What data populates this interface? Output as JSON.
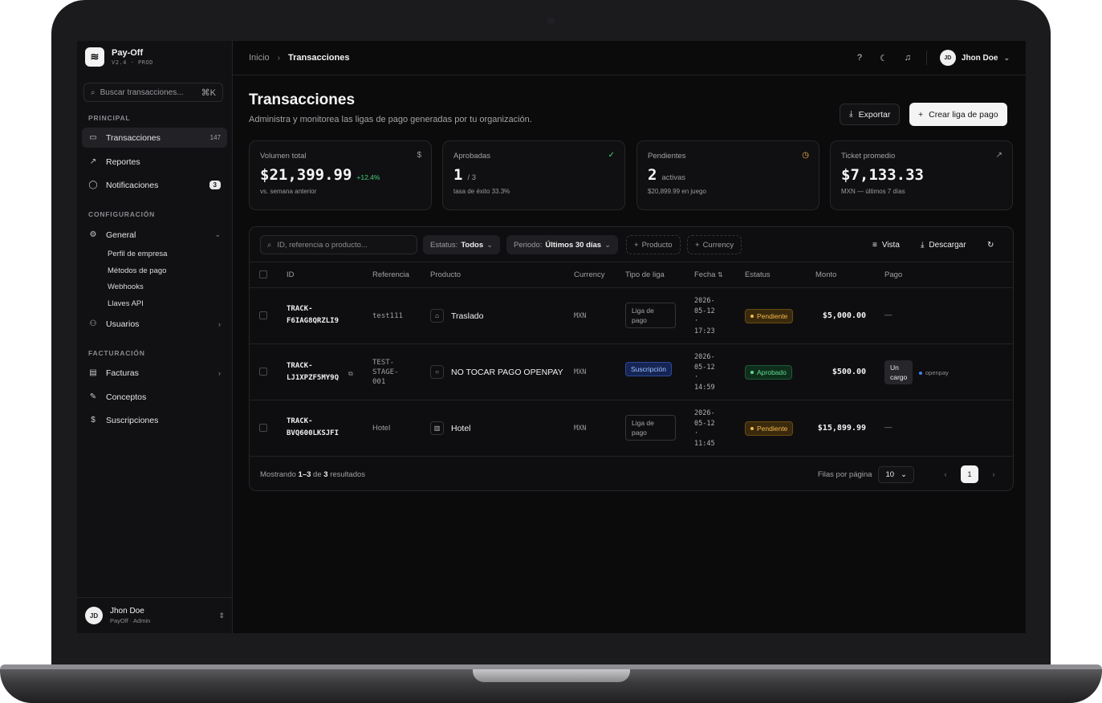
{
  "app": {
    "name": "Pay-Off",
    "version": "V2.4",
    "env": "PROD"
  },
  "sidebar": {
    "search_placeholder": "Buscar transacciones...",
    "search_shortcut": "⌘K",
    "sections": {
      "principal": "PRINCIPAL",
      "configuracion": "CONFIGURACIÓN",
      "facturacion": "FACTURACIÓN"
    },
    "items": [
      {
        "label": "Transacciones",
        "icon": "card-icon",
        "count": "147"
      },
      {
        "label": "Reportes",
        "icon": "chart-line-icon"
      },
      {
        "label": "Notificaciones",
        "icon": "chat-bubble-icon",
        "badge": "3"
      },
      {
        "label": "General",
        "icon": "gear-icon"
      },
      {
        "label": "Usuarios",
        "icon": "user-plus-icon"
      },
      {
        "label": "Facturas",
        "icon": "file-icon"
      },
      {
        "label": "Conceptos",
        "icon": "edit-box-icon"
      },
      {
        "label": "Suscripciones",
        "icon": "dollar-icon"
      }
    ],
    "general_sub": [
      "Perfil de empresa",
      "Métodos de pago",
      "Webhooks",
      "Llaves API"
    ],
    "user": {
      "initials": "JD",
      "name": "Jhon Doe",
      "role": "PayOff · Admin"
    }
  },
  "topbar": {
    "breadcrumb_home": "Inicio",
    "breadcrumb_current": "Transacciones",
    "user": {
      "initials": "JD",
      "name": "Jhon Doe"
    }
  },
  "header": {
    "title": "Transacciones",
    "subtitle": "Administra y monitorea las ligas de pago generadas por tu organización.",
    "export_label": "Exportar",
    "create_label": "Crear liga de pago"
  },
  "stats": [
    {
      "label": "Volumen total",
      "value": "$21,399.99",
      "delta": "+12.4%",
      "foot": "vs. semana anterior",
      "icon": "dollar-icon"
    },
    {
      "label": "Aprobadas",
      "value": "1",
      "small": "/ 3",
      "foot": "tasa de éxito 33.3%",
      "icon": "check-circle-icon"
    },
    {
      "label": "Pendientes",
      "value": "2",
      "small": "activas",
      "foot": "$20,899.99 en juego",
      "icon": "clock-icon"
    },
    {
      "label": "Ticket promedio",
      "value": "$7,133.33",
      "foot": "MXN — últimos 7 días",
      "icon": "chart-line-icon"
    }
  ],
  "toolbar": {
    "search_placeholder": "ID, referencia o producto...",
    "status_label": "Estatus:",
    "status_value": "Todos",
    "period_label": "Periodo:",
    "period_value": "Últimos 30 días",
    "product_filter": "Producto",
    "currency_filter": "Currency",
    "view_label": "Vista",
    "download_label": "Descargar"
  },
  "table": {
    "columns": [
      "ID",
      "Referencia",
      "Producto",
      "Currency",
      "Tipo de liga",
      "Fecha",
      "Estatus",
      "Monto",
      "Pago"
    ],
    "rows": [
      {
        "id1": "TRACK-",
        "id2": "F6IAG8QRZLI9",
        "ref": "test111",
        "product": "Traslado",
        "currency": "MXN",
        "tipo": "Liga de pago",
        "date": [
          "2026-",
          "05-12",
          "·",
          "17:23"
        ],
        "status": "Pendiente",
        "amount": "$5,000.00",
        "pago": "—"
      },
      {
        "id1": "TRACK-",
        "id2": "LJ1XPZF5MY9Q",
        "ref": "TEST-STAGE-001",
        "ref_lines": [
          "TEST-",
          "STAGE-",
          "001"
        ],
        "product": "NO TOCAR PAGO OPENPAY",
        "currency": "MXN",
        "tipo": "Suscripción",
        "date": [
          "2026-",
          "05-12",
          "·",
          "14:59"
        ],
        "status": "Aprobado",
        "amount": "$500.00",
        "pago": "Un cargo",
        "pago_lines": [
          "Un",
          "cargo"
        ],
        "pago_provider": "openpay"
      },
      {
        "id1": "TRACK-",
        "id2": "BVQ600LKSJFI",
        "ref": "Hotel",
        "product": "Hotel",
        "currency": "MXN",
        "tipo": "Liga de pago",
        "date": [
          "2026-",
          "05-12",
          "·",
          "11:45"
        ],
        "status": "Pendiente",
        "amount": "$15,899.99",
        "pago": "—"
      }
    ]
  },
  "footer": {
    "showing_prefix": "Mostrando",
    "range": "1–3",
    "of": "de",
    "total": "3",
    "suffix": "resultados",
    "rows_per_page_label": "Filas por página",
    "rows_per_page": "10",
    "page": "1"
  },
  "colors": {
    "accent_green": "#44d07a",
    "pending": "#f5b84a",
    "approved": "#5fdc8e",
    "subscription": "#9cc0ff"
  }
}
